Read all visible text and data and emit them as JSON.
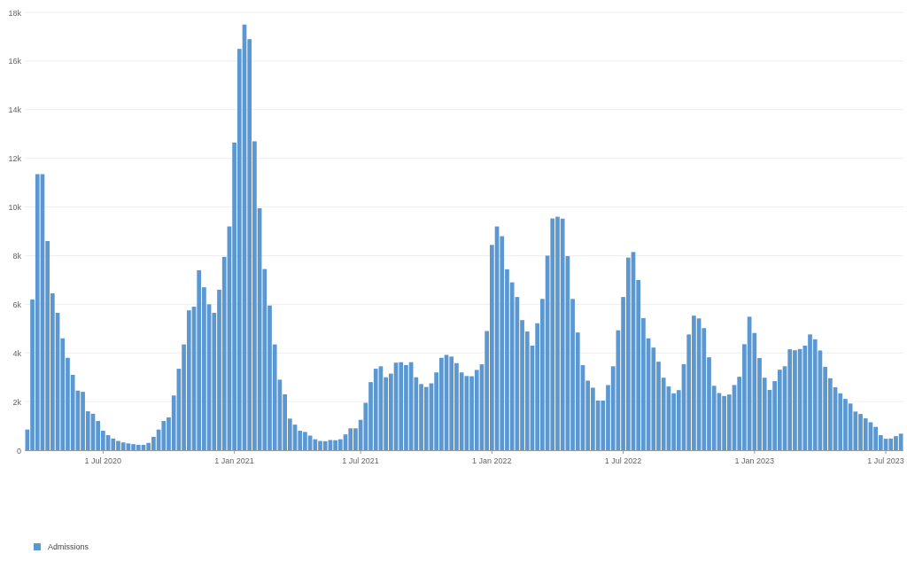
{
  "chart": {
    "chart_data": {
      "type": "bar",
      "series": [
        {
          "name": "Admissions",
          "color": "#5b97d1",
          "values": [
            850,
            6200,
            11350,
            11350,
            8600,
            6450,
            5650,
            4600,
            3800,
            3100,
            2450,
            2400,
            1600,
            1500,
            1200,
            800,
            620,
            480,
            380,
            320,
            280,
            250,
            220,
            220,
            300,
            550,
            850,
            1200,
            1350,
            2250,
            3350,
            4350,
            5750,
            5900,
            7400,
            6700,
            6000,
            5650,
            6600,
            7950,
            9200,
            12650,
            16500,
            17500,
            16900,
            12700,
            9950,
            7450,
            5950,
            4350,
            2900,
            2300,
            1300,
            1050,
            800,
            750,
            600,
            450,
            380,
            370,
            420,
            410,
            450,
            650,
            900,
            900,
            1250,
            1950,
            2800,
            3350,
            3450,
            3000,
            3150,
            3600,
            3620,
            3500,
            3620,
            3000,
            2720,
            2600,
            2750,
            3200,
            3800,
            3920,
            3850,
            3580,
            3200,
            3050,
            3040,
            3300,
            3530,
            4900,
            8440,
            9200,
            8800,
            7440,
            6900,
            6300,
            5350,
            4880,
            4300,
            5220,
            6220,
            8000,
            9530,
            9600,
            9520,
            7980,
            6220,
            4840,
            3500,
            2860,
            2570,
            2040,
            2040,
            2680,
            3450,
            4930,
            6300,
            7920,
            8150,
            7000,
            5430,
            4600,
            4220,
            3640,
            2980,
            2620,
            2340,
            2470,
            3540,
            4760,
            5530,
            5420,
            5020,
            3820,
            2650,
            2350,
            2230,
            2290,
            2680,
            3020,
            4360,
            5490,
            4820,
            3790,
            2980,
            2480,
            2840,
            3310,
            3450,
            4150,
            4110,
            4160,
            4300,
            4760,
            4560,
            4100,
            3430,
            2960,
            2590,
            2340,
            2110,
            1920,
            1590,
            1490,
            1310,
            1150,
            960,
            620,
            470,
            480,
            580,
            680
          ]
        }
      ],
      "categories": [
        null,
        null,
        null,
        null,
        null,
        null,
        null,
        null,
        null,
        null,
        null,
        null,
        null,
        null,
        null,
        "1 Jul 2020",
        null,
        null,
        null,
        null,
        null,
        null,
        null,
        null,
        null,
        null,
        null,
        null,
        null,
        null,
        null,
        null,
        null,
        null,
        null,
        null,
        null,
        null,
        null,
        null,
        null,
        "1 Jan 2021",
        null,
        null,
        null,
        null,
        null,
        null,
        null,
        null,
        null,
        null,
        null,
        null,
        null,
        null,
        null,
        null,
        null,
        null,
        null,
        null,
        null,
        null,
        null,
        null,
        "1 Jul 2021",
        null,
        null,
        null,
        null,
        null,
        null,
        null,
        null,
        null,
        null,
        null,
        null,
        null,
        null,
        null,
        null,
        null,
        null,
        null,
        null,
        null,
        null,
        null,
        null,
        null,
        "1 Jan 2022",
        null,
        null,
        null,
        null,
        null,
        null,
        null,
        null,
        null,
        null,
        null,
        null,
        null,
        null,
        null,
        null,
        null,
        null,
        null,
        null,
        null,
        null,
        null,
        null,
        null,
        "1 Jul 2022",
        null,
        null,
        null,
        null,
        null,
        null,
        null,
        null,
        null,
        null,
        null,
        null,
        null,
        null,
        null,
        null,
        null,
        null,
        null,
        null,
        null,
        null,
        null,
        null,
        null,
        "1 Jan 2023",
        null,
        null,
        null,
        null,
        null,
        null,
        null,
        null,
        null,
        null,
        null,
        null,
        null,
        null,
        null,
        null,
        null,
        null,
        null,
        null,
        null,
        null,
        null,
        null,
        null,
        "1 Jul 2023",
        null,
        null,
        null
      ],
      "grid": true,
      "ylim": [
        0,
        18000
      ],
      "yticks": [
        {
          "value": 0,
          "label": "0"
        },
        {
          "value": 2000,
          "label": "2k"
        },
        {
          "value": 4000,
          "label": "4k"
        },
        {
          "value": 6000,
          "label": "6k"
        },
        {
          "value": 8000,
          "label": "8k"
        },
        {
          "value": 10000,
          "label": "10k"
        },
        {
          "value": 12000,
          "label": "12k"
        },
        {
          "value": 14000,
          "label": "14k"
        },
        {
          "value": 16000,
          "label": "16k"
        },
        {
          "value": 18000,
          "label": "18k"
        }
      ]
    }
  }
}
